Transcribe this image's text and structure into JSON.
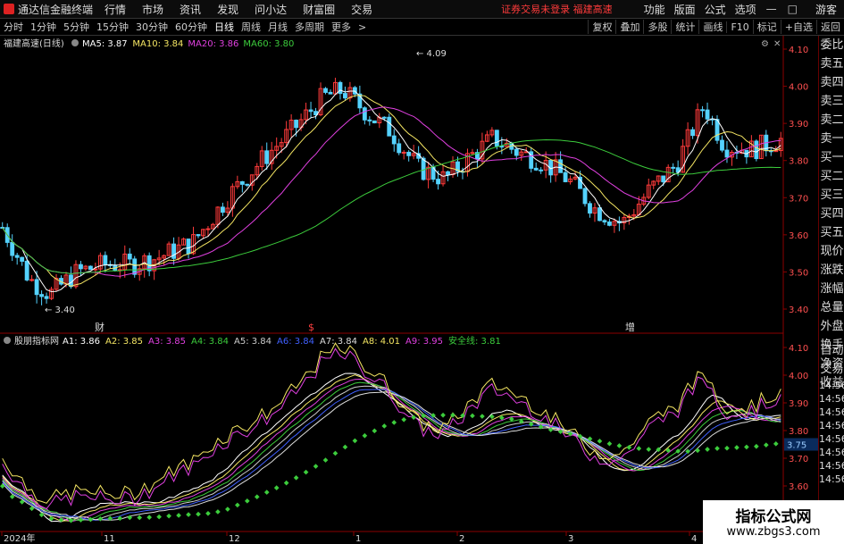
{
  "app_title": "通达信金融终端",
  "menu": [
    "行情",
    "市场",
    "资讯",
    "发现",
    "问小达",
    "财富圈",
    "交易"
  ],
  "notice": "证券交易未登录  福建高速",
  "right_menu": [
    "功能",
    "版面",
    "公式",
    "选项"
  ],
  "guest": "游客",
  "periods": [
    "分时",
    "1分钟",
    "5分钟",
    "15分钟",
    "30分钟",
    "60分钟",
    "日线",
    "周线",
    "月线",
    "多周期",
    "更多"
  ],
  "active_period": "日线",
  "toolbar_right": [
    "复权",
    "叠加",
    "多股",
    "统计",
    "画线",
    "F10",
    "标记",
    "+自选",
    "返回"
  ],
  "side_labels": [
    "委比",
    "卖五",
    "卖四",
    "卖三",
    "卖二",
    "卖一",
    "买一",
    "买二",
    "买三",
    "买四",
    "买五",
    "现价",
    "涨跌",
    "涨幅",
    "总量",
    "外盘",
    "换手",
    "净资",
    "收益"
  ],
  "side_labels_lower": [
    "自动",
    "交易"
  ],
  "side_times": [
    "14:56",
    "14:56",
    "14:56",
    "14:56",
    "14:56",
    "14:56",
    "14:56",
    "14:56"
  ],
  "top_chart": {
    "stock_label": "福建高速(日线)",
    "ma_labels": [
      {
        "text": "MA5: 3.87",
        "color": "#ffffff"
      },
      {
        "text": "MA10: 3.84",
        "color": "#f5e663"
      },
      {
        "text": "MA20: 3.86",
        "color": "#e040e0"
      },
      {
        "text": "MA60: 3.80",
        "color": "#3ccc3c"
      }
    ],
    "y_ticks": [
      "4.10",
      "4.00",
      "3.90",
      "3.80",
      "3.70",
      "3.60",
      "3.50",
      "3.40"
    ],
    "high_label": "4.09",
    "low_label": "3.40",
    "markers": [
      "财",
      "$",
      "增"
    ]
  },
  "bottom_chart": {
    "indicator_label": "股朋指标网",
    "lines": [
      {
        "text": "A1: 3.86",
        "color": "#ffffff"
      },
      {
        "text": "A2: 3.85",
        "color": "#f5e663"
      },
      {
        "text": "A3: 3.85",
        "color": "#e040e0"
      },
      {
        "text": "A4: 3.84",
        "color": "#3ccc3c"
      },
      {
        "text": "A5: 3.84",
        "color": "#cccccc"
      },
      {
        "text": "A6: 3.84",
        "color": "#4060ff"
      },
      {
        "text": "A7: 3.84",
        "color": "#dddddd"
      },
      {
        "text": "A8: 4.01",
        "color": "#f5e663"
      },
      {
        "text": "A9: 3.95",
        "color": "#e040e0"
      },
      {
        "text": "安全线: 3.81",
        "color": "#3ccc3c"
      }
    ],
    "y_ticks": [
      "4.10",
      "4.00",
      "3.90",
      "3.80",
      "3.70",
      "3.60"
    ],
    "current_value": "3.75"
  },
  "x_labels": [
    "2024年",
    "11",
    "12",
    "1",
    "2",
    "3",
    "4"
  ],
  "watermark": {
    "title": "指标公式网",
    "url": "www.zbgs3.com"
  },
  "colors": {
    "up": "#ff3b3b",
    "down": "#54d2ff",
    "ma60": "#3ccc3c"
  }
}
